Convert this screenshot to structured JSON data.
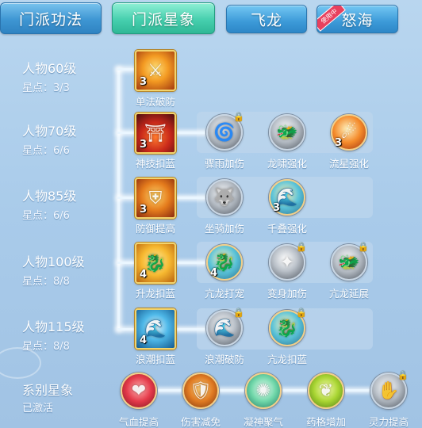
{
  "tabs": {
    "main": [
      {
        "label": "门派功法"
      },
      {
        "label": "门派星象"
      }
    ],
    "sub": [
      {
        "label": "飞龙"
      },
      {
        "label": "怒海",
        "badge": "使用中"
      }
    ]
  },
  "tiers": [
    {
      "name": "人物60级",
      "stars": "星点：3/3"
    },
    {
      "name": "人物70级",
      "stars": "星点：6/6"
    },
    {
      "name": "人物85级",
      "stars": "星点：6/6"
    },
    {
      "name": "人物100级",
      "stars": "星点：8/8"
    },
    {
      "name": "人物115级",
      "stars": "星点：8/8"
    }
  ],
  "main_skills": [
    {
      "name": "单法破防",
      "level": "3",
      "icon": "sword-break-icon"
    },
    {
      "name": "神技扣蓝",
      "level": "3",
      "icon": "fire-temple-icon"
    },
    {
      "name": "防御提高",
      "level": "3",
      "icon": "shield-icon"
    },
    {
      "name": "升龙扣蓝",
      "level": "4",
      "icon": "golden-dragon-icon"
    },
    {
      "name": "浪潮扣蓝",
      "level": "4",
      "icon": "wave-icon"
    }
  ],
  "sub_skills": {
    "row2": [
      {
        "name": "骤雨加伤",
        "level": "",
        "locked": true,
        "icon": "swirl-icon"
      },
      {
        "name": "龙啸强化",
        "level": "",
        "locked": false,
        "icon": "dragon-roar-icon"
      },
      {
        "name": "流星强化",
        "level": "3",
        "locked": false,
        "icon": "meteor-icon"
      }
    ],
    "row3": [
      {
        "name": "坐骑加伤",
        "level": "",
        "locked": false,
        "icon": "mount-wolf-icon"
      },
      {
        "name": "千叠强化",
        "level": "3",
        "locked": false,
        "icon": "thousand-wave-icon"
      }
    ],
    "row4": [
      {
        "name": "亢龙打宠",
        "level": "4",
        "locked": false,
        "icon": "dragon-strike-icon"
      },
      {
        "name": "变身加伤",
        "level": "",
        "locked": true,
        "icon": "transform-icon"
      },
      {
        "name": "亢龙延展",
        "level": "",
        "locked": true,
        "icon": "dragon-extend-icon"
      }
    ],
    "row5": [
      {
        "name": "浪潮破防",
        "level": "",
        "locked": true,
        "icon": "tide-break-icon"
      },
      {
        "name": "亢龙扣蓝",
        "level": "",
        "locked": true,
        "icon": "dragon-mana-icon"
      }
    ]
  },
  "series": {
    "title": "系别星象",
    "status": "已激活",
    "items": [
      {
        "name": "气血提高",
        "icon": "heart-icon"
      },
      {
        "name": "伤害减免",
        "icon": "body-guard-icon"
      },
      {
        "name": "凝神聚气",
        "icon": "meditate-icon"
      },
      {
        "name": "药格增加",
        "icon": "herb-icon"
      },
      {
        "name": "灵力提高",
        "icon": "spirit-hand-icon",
        "locked": true
      }
    ]
  },
  "colors": {
    "background": "#aacbea",
    "tab_blue": "#3e96d3",
    "tab_green": "#46cfae",
    "badge": "#e8405e",
    "border_gold": "#f2d46e"
  }
}
